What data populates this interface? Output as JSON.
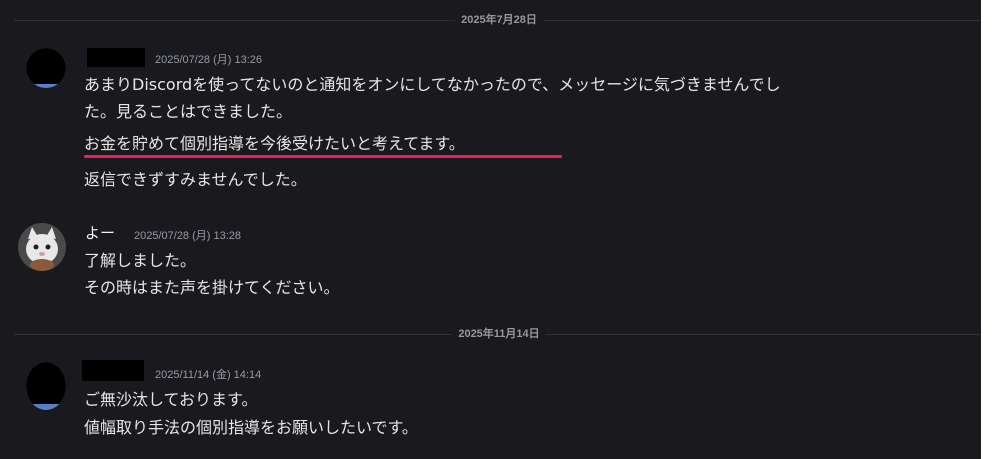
{
  "date_dividers": [
    "2025年7月28日",
    "2025年11月14日"
  ],
  "messages": [
    {
      "author": "",
      "timestamp": "2025/07/28 (月) 13:26",
      "lines": [
        "あまりDiscordを使ってないのと通知をオンにしてなかったので、メッセージに気づきませんでし",
        "た。見ることはできました。",
        "お金を貯めて個別指導を今後受けたいと考えてます。",
        "返信できずすみませんでした。"
      ]
    },
    {
      "author": "よー",
      "timestamp": "2025/07/28 (月) 13:28",
      "lines": [
        "了解しました。",
        "その時はまた声を掛けてください。"
      ]
    },
    {
      "author": "",
      "timestamp": "2025/11/14 (金) 14:14",
      "lines": [
        "ご無沙汰しております。",
        "値幅取り手法の個別指導をお願いしたいです。"
      ]
    }
  ],
  "colors": {
    "background": "#1a1a1e",
    "highlight_underline": "#e3245c",
    "avatar_blue": "#5b7fc4"
  },
  "icons": {
    "avatar_2": "cat-avatar-icon"
  }
}
